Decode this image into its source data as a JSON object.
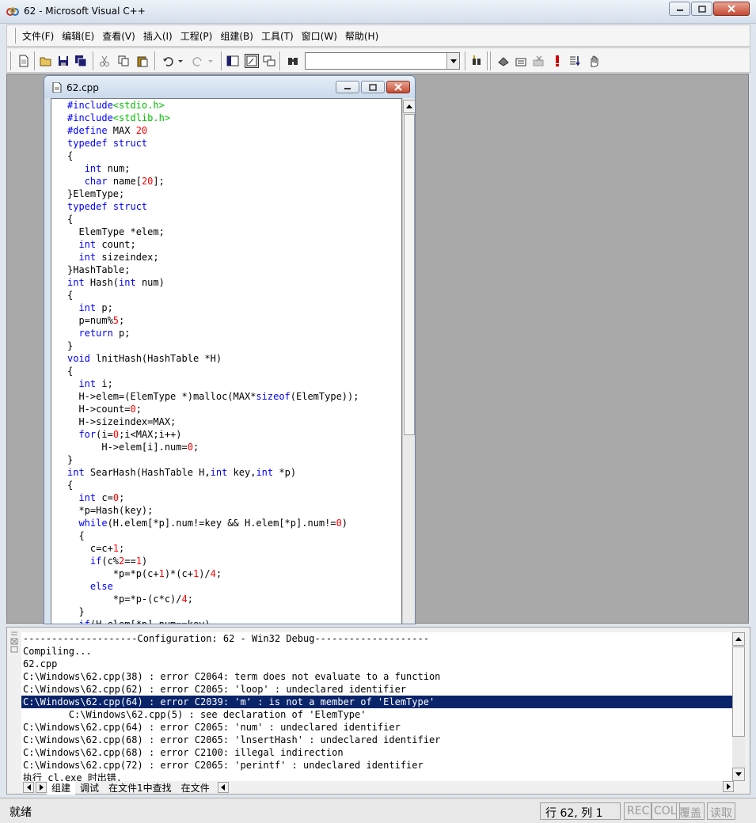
{
  "window": {
    "title": "62 - Microsoft Visual C++"
  },
  "menu": [
    "文件(F)",
    "编辑(E)",
    "查看(V)",
    "插入(I)",
    "工程(P)",
    "组建(B)",
    "工具(T)",
    "窗口(W)",
    "帮助(H)"
  ],
  "toolbar": {
    "find_combo_value": ""
  },
  "editor": {
    "filename": "62.cpp",
    "lines": [
      [
        [
          "kw",
          "#include"
        ],
        [
          "str",
          "<stdio.h>"
        ]
      ],
      [
        [
          "kw",
          "#include"
        ],
        [
          "str",
          "<stdlib.h>"
        ]
      ],
      [
        [
          "kw",
          "#define"
        ],
        [
          "t",
          " MAX "
        ],
        [
          "num",
          "20"
        ]
      ],
      [
        [
          "kw",
          "typedef"
        ],
        [
          "t",
          " "
        ],
        [
          "kw",
          "struct"
        ]
      ],
      [
        [
          "t",
          "{"
        ]
      ],
      [
        [
          "t",
          "   "
        ],
        [
          "kw",
          "int"
        ],
        [
          "t",
          " num;"
        ]
      ],
      [
        [
          "t",
          "   "
        ],
        [
          "kw",
          "char"
        ],
        [
          "t",
          " name["
        ],
        [
          "num",
          "20"
        ],
        [
          "t",
          "];"
        ]
      ],
      [
        [
          "t",
          "}ElemType;"
        ]
      ],
      [
        [
          "kw",
          "typedef"
        ],
        [
          "t",
          " "
        ],
        [
          "kw",
          "struct"
        ]
      ],
      [
        [
          "t",
          "{"
        ]
      ],
      [
        [
          "t",
          "  ElemType *elem;"
        ]
      ],
      [
        [
          "t",
          "  "
        ],
        [
          "kw",
          "int"
        ],
        [
          "t",
          " count;"
        ]
      ],
      [
        [
          "t",
          "  "
        ],
        [
          "kw",
          "int"
        ],
        [
          "t",
          " sizeindex;"
        ]
      ],
      [
        [
          "t",
          "}HashTable;"
        ]
      ],
      [
        [
          "kw",
          "int"
        ],
        [
          "t",
          " Hash("
        ],
        [
          "kw",
          "int"
        ],
        [
          "t",
          " num)"
        ]
      ],
      [
        [
          "t",
          "{"
        ]
      ],
      [
        [
          "t",
          "  "
        ],
        [
          "kw",
          "int"
        ],
        [
          "t",
          " p;"
        ]
      ],
      [
        [
          "t",
          "  p=num%"
        ],
        [
          "num",
          "5"
        ],
        [
          "t",
          ";"
        ]
      ],
      [
        [
          "t",
          "  "
        ],
        [
          "kw",
          "return"
        ],
        [
          "t",
          " p;"
        ]
      ],
      [
        [
          "t",
          "}"
        ]
      ],
      [
        [
          "kw",
          "void"
        ],
        [
          "t",
          " lnitHash(HashTable *H)"
        ]
      ],
      [
        [
          "t",
          "{"
        ]
      ],
      [
        [
          "t",
          "  "
        ],
        [
          "kw",
          "int"
        ],
        [
          "t",
          " i;"
        ]
      ],
      [
        [
          "t",
          "  H->elem=(ElemType *)malloc(MAX*"
        ],
        [
          "kw",
          "sizeof"
        ],
        [
          "t",
          "(ElemType));"
        ]
      ],
      [
        [
          "t",
          "  H->count="
        ],
        [
          "num",
          "0"
        ],
        [
          "t",
          ";"
        ]
      ],
      [
        [
          "t",
          "  H->sizeindex=MAX;"
        ]
      ],
      [
        [
          "t",
          "  "
        ],
        [
          "kw",
          "for"
        ],
        [
          "t",
          "(i="
        ],
        [
          "num",
          "0"
        ],
        [
          "t",
          ";i<MAX;i++)"
        ]
      ],
      [
        [
          "t",
          "      H->elem[i].num="
        ],
        [
          "num",
          "0"
        ],
        [
          "t",
          ";"
        ]
      ],
      [
        [
          "t",
          "}"
        ]
      ],
      [
        [
          "kw",
          "int"
        ],
        [
          "t",
          " SearHash(HashTable H,"
        ],
        [
          "kw",
          "int"
        ],
        [
          "t",
          " key,"
        ],
        [
          "kw",
          "int"
        ],
        [
          "t",
          " *p)"
        ]
      ],
      [
        [
          "t",
          "{"
        ]
      ],
      [
        [
          "t",
          "  "
        ],
        [
          "kw",
          "int"
        ],
        [
          "t",
          " c="
        ],
        [
          "num",
          "0"
        ],
        [
          "t",
          ";"
        ]
      ],
      [
        [
          "t",
          "  *p=Hash(key);"
        ]
      ],
      [
        [
          "t",
          "  "
        ],
        [
          "kw",
          "while"
        ],
        [
          "t",
          "(H.elem[*p].num!=key && H.elem[*p].num!="
        ],
        [
          "num",
          "0"
        ],
        [
          "t",
          ")"
        ]
      ],
      [
        [
          "t",
          "  {"
        ]
      ],
      [
        [
          "t",
          "    c=c+"
        ],
        [
          "num",
          "1"
        ],
        [
          "t",
          ";"
        ]
      ],
      [
        [
          "t",
          "    "
        ],
        [
          "kw",
          "if"
        ],
        [
          "t",
          "(c%"
        ],
        [
          "num",
          "2"
        ],
        [
          "t",
          "=="
        ],
        [
          "num",
          "1"
        ],
        [
          "t",
          ")"
        ]
      ],
      [
        [
          "t",
          "        *p=*p(c+"
        ],
        [
          "num",
          "1"
        ],
        [
          "t",
          ")*(c+"
        ],
        [
          "num",
          "1"
        ],
        [
          "t",
          ")/"
        ],
        [
          "num",
          "4"
        ],
        [
          "t",
          ";"
        ]
      ],
      [
        [
          "t",
          "    "
        ],
        [
          "kw",
          "else"
        ]
      ],
      [
        [
          "t",
          "        *p=*p-(c*c)/"
        ],
        [
          "num",
          "4"
        ],
        [
          "t",
          ";"
        ]
      ],
      [
        [
          "t",
          "  }"
        ]
      ],
      [
        [
          "t",
          "  "
        ],
        [
          "kw",
          "if"
        ],
        [
          "t",
          "(H.elem[*p].num==key)"
        ]
      ]
    ]
  },
  "output": {
    "lines": [
      "--------------------Configuration: 62 - Win32 Debug--------------------",
      "Compiling...",
      "62.cpp",
      "C:\\Windows\\62.cpp(38) : error C2064: term does not evaluate to a function",
      "C:\\Windows\\62.cpp(62) : error C2065: 'loop' : undeclared identifier",
      "C:\\Windows\\62.cpp(64) : error C2039: 'm' : is not a member of 'ElemType'",
      "        C:\\Windows\\62.cpp(5) : see declaration of 'ElemType'",
      "C:\\Windows\\62.cpp(64) : error C2065: 'num' : undeclared identifier",
      "C:\\Windows\\62.cpp(68) : error C2065: 'lnsertHash' : undeclared identifier",
      "C:\\Windows\\62.cpp(68) : error C2100: illegal indirection",
      "C:\\Windows\\62.cpp(72) : error C2065: 'perintf' : undeclared identifier",
      "执行 cl.exe 时出错."
    ],
    "selected_index": 5,
    "tabs": [
      "组建",
      "调试",
      "在文件1中查找",
      "在文件"
    ]
  },
  "status": {
    "text": "就绪",
    "position": "行 62, 列 1",
    "indicators": [
      "REC",
      "COL",
      "覆盖",
      "读取"
    ]
  }
}
